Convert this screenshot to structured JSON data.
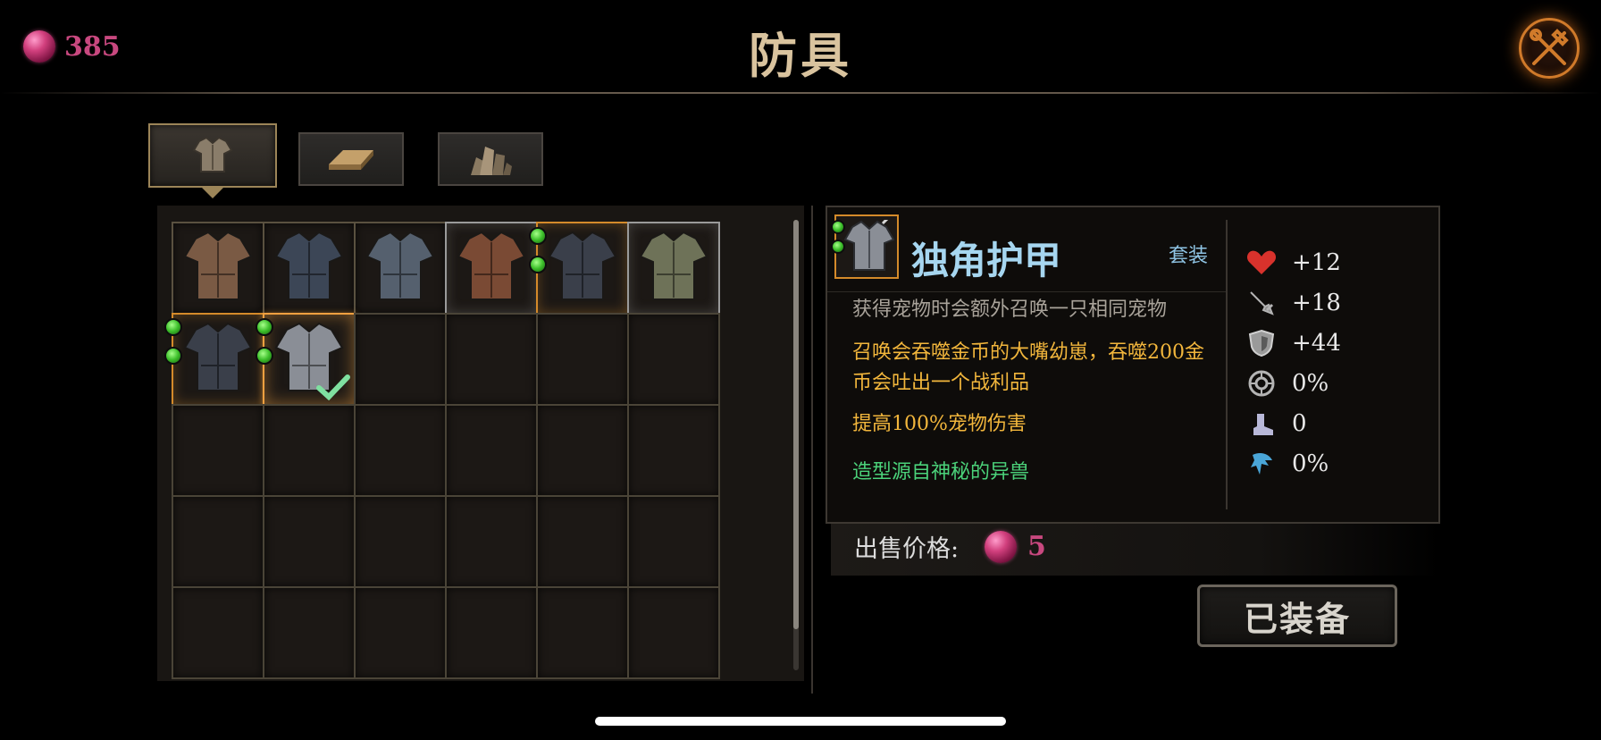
{
  "header": {
    "currency_value": "385",
    "title": "防具",
    "currency_icon": "gem-icon",
    "close_icon": "close-crossed-tools-icon"
  },
  "tabs": [
    {
      "name": "armor",
      "icon": "chestplate-icon",
      "active": true
    },
    {
      "name": "material",
      "icon": "ingot-icon",
      "active": false
    },
    {
      "name": "crystal",
      "icon": "crystal-icon",
      "active": false
    }
  ],
  "inventory": {
    "rows": [
      [
        {
          "rarity": "common",
          "tint": "#7a5a44",
          "sockets": 0
        },
        {
          "rarity": "common",
          "tint": "#3c4656",
          "sockets": 0
        },
        {
          "rarity": "common",
          "tint": "#55606e",
          "sockets": 0
        },
        {
          "rarity": "silver",
          "tint": "#7a4a34",
          "sockets": 0
        },
        {
          "rarity": "gold",
          "tint": "#3a3f4a",
          "sockets": 2
        },
        {
          "rarity": "silver",
          "tint": "#6e7258",
          "sockets": 0
        }
      ],
      [
        {
          "rarity": "gold",
          "tint": "#3a3f4a",
          "sockets": 2
        },
        {
          "rarity": "selected",
          "tint": "#8a8e96",
          "sockets": 2,
          "equipped": true
        },
        {
          "empty": true
        },
        {
          "empty": true
        },
        {
          "empty": true
        },
        {
          "empty": true
        }
      ],
      [
        {
          "empty": true
        },
        {
          "empty": true
        },
        {
          "empty": true
        },
        {
          "empty": true
        },
        {
          "empty": true
        },
        {
          "empty": true
        }
      ],
      [
        {
          "empty": true
        },
        {
          "empty": true
        },
        {
          "empty": true
        },
        {
          "empty": true
        },
        {
          "empty": true
        },
        {
          "empty": true
        }
      ],
      [
        {
          "empty": true
        },
        {
          "empty": true
        },
        {
          "empty": true
        },
        {
          "empty": true
        },
        {
          "empty": true
        },
        {
          "empty": true
        }
      ]
    ]
  },
  "detail": {
    "name": "独角护甲",
    "set_label": "套装",
    "description_gray": "获得宠物时会额外召唤一只相同宠物",
    "description_yellow_1": "召唤会吞噬金币的大嘴幼崽，吞噬200金币会吐出一个战利品",
    "description_yellow_2": "提高100%宠物伤害",
    "description_green": "造型源自神秘的异兽",
    "stats": [
      {
        "icon": "heart-icon",
        "value": "+12"
      },
      {
        "icon": "sword-icon",
        "value": "+18"
      },
      {
        "icon": "shield-icon",
        "value": "+44"
      },
      {
        "icon": "crit-target-icon",
        "value": "0%"
      },
      {
        "icon": "boot-icon",
        "value": "0"
      },
      {
        "icon": "lifesteal-icon",
        "value": "0%"
      }
    ]
  },
  "sell": {
    "label": "出售价格:",
    "value": "5"
  },
  "equip_button": {
    "label": "已装备"
  },
  "colors": {
    "gem": "#c8487f",
    "title": "#d9c39e",
    "item_name": "#a6d6f0",
    "yellow_text": "#f2b63c",
    "green_text": "#4bd27a",
    "gold_border": "#d48a2a"
  }
}
